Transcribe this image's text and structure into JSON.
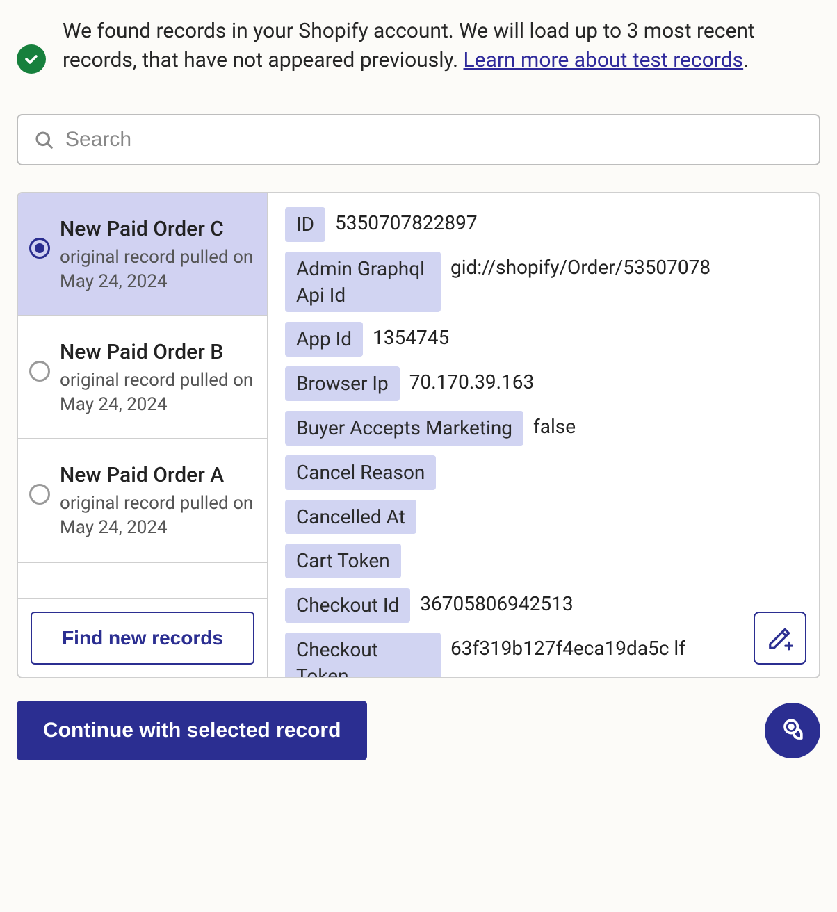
{
  "banner": {
    "text_before_link": "We found records in your Shopify account. We will load up to 3 most recent records, that have not appeared previously. ",
    "link_text": "Learn more about test records",
    "text_after_link": "."
  },
  "search": {
    "placeholder": "Search"
  },
  "records": [
    {
      "title": "New Paid Order C",
      "subtitle": "original record pulled on May 24, 2024",
      "selected": true
    },
    {
      "title": "New Paid Order B",
      "subtitle": "original record pulled on May 24, 2024",
      "selected": false
    },
    {
      "title": "New Paid Order A",
      "subtitle": "original record pulled on May 24, 2024",
      "selected": false
    }
  ],
  "find_button": "Find new records",
  "detail_fields": [
    {
      "key": "ID",
      "value": "5350707822897"
    },
    {
      "key": "Admin Graphql Api Id",
      "value": "gid://shopify/Order/53507078",
      "tall": true
    },
    {
      "key": "App Id",
      "value": "1354745"
    },
    {
      "key": "Browser Ip",
      "value": "70.170.39.163"
    },
    {
      "key": "Buyer Accepts Marketing",
      "value": "false"
    },
    {
      "key": "Cancel Reason",
      "value": ""
    },
    {
      "key": "Cancelled At",
      "value": ""
    },
    {
      "key": "Cart Token",
      "value": ""
    },
    {
      "key": "Checkout Id",
      "value": "36705806942513"
    },
    {
      "key": "Checkout Token",
      "value": "63f319b127f4eca19da5c           lf",
      "tall": true
    }
  ],
  "continue_button": "Continue with selected record"
}
